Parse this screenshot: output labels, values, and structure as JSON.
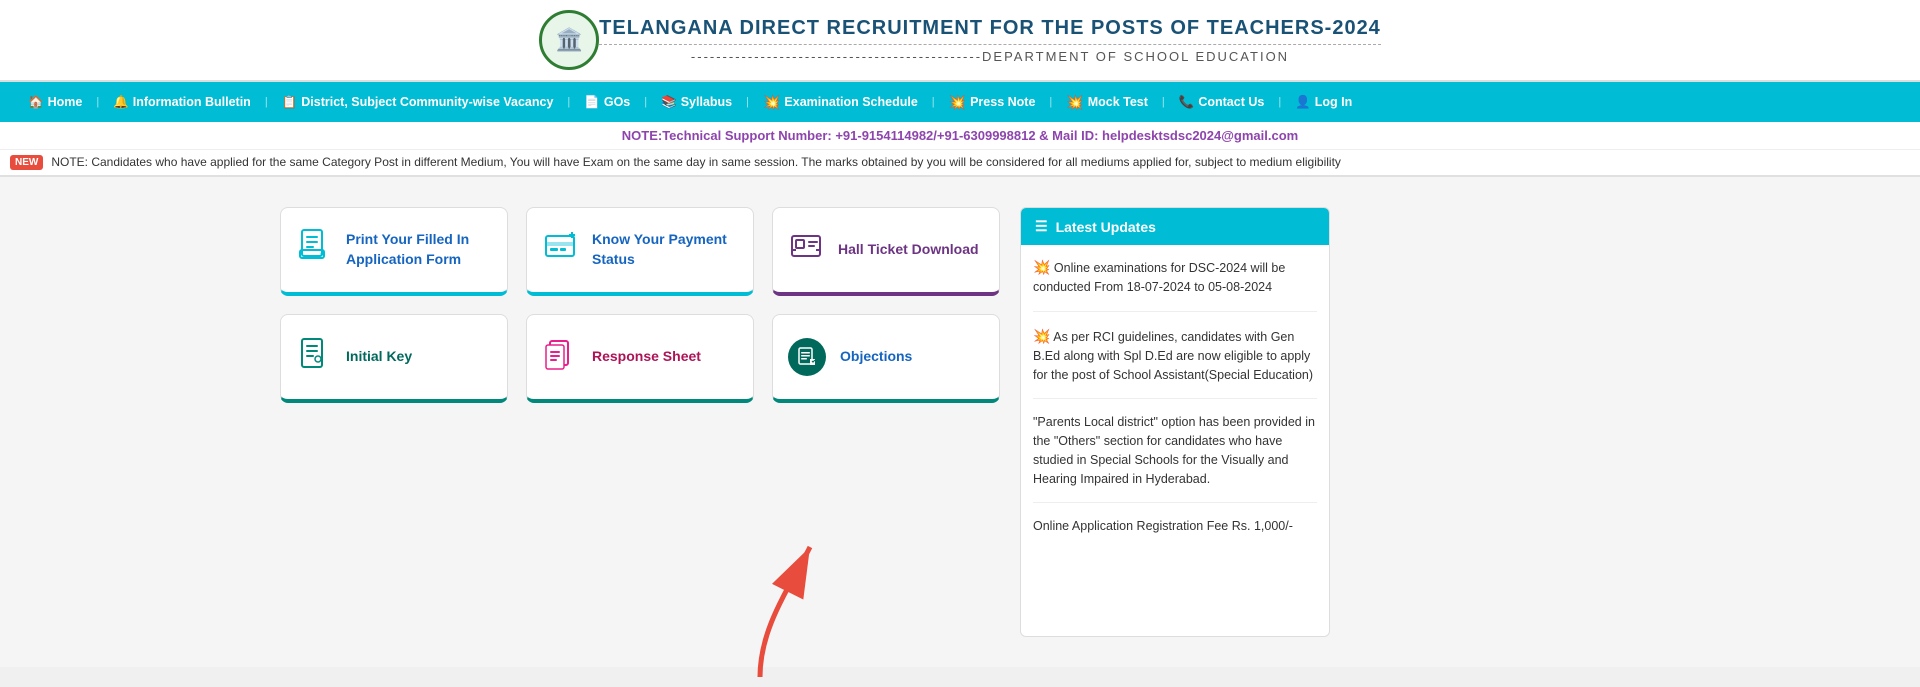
{
  "header": {
    "title": "TELANGANA DIRECT RECRUITMENT FOR THE POSTS OF TEACHERS-2024",
    "subtitle": "----------------------------------------------DEPARTMENT OF SCHOOL EDUCATION",
    "logo_icon": "🏛️"
  },
  "navbar": {
    "items": [
      {
        "id": "home",
        "label": "Home",
        "icon": "🏠"
      },
      {
        "id": "info-bulletin",
        "label": "Information Bulletin",
        "icon": "🔔"
      },
      {
        "id": "vacancy",
        "label": "District, Subject Community-wise Vacancy",
        "icon": "📋"
      },
      {
        "id": "gos",
        "label": "GOs",
        "icon": "📄"
      },
      {
        "id": "syllabus",
        "label": "Syllabus",
        "icon": "📚"
      },
      {
        "id": "exam-schedule",
        "label": "Examination Schedule",
        "icon": "🔥"
      },
      {
        "id": "press-note",
        "label": "Press Note",
        "icon": "🔥"
      },
      {
        "id": "mock-test",
        "label": "Mock Test",
        "icon": "🔥"
      },
      {
        "id": "contact-us",
        "label": "Contact Us",
        "icon": "📞"
      },
      {
        "id": "log-in",
        "label": "Log In",
        "icon": "👤"
      }
    ]
  },
  "notice": {
    "text": "NOTE:Technical Support Number: +91-9154114982/+91-6309998812 & Mail ID: helpdesktsdsc2024@gmail.com"
  },
  "marquee": {
    "badge": "NEW",
    "text": "NOTE: Candidates who have applied for the same Category Post in different Medium, You will have Exam on the same day in same session. The marks obtained by you will be considered for all mediums applied for, subject to medium eligibility"
  },
  "cards": [
    {
      "id": "print-application",
      "label": "Print Your Filled In Application Form",
      "icon": "📋",
      "icon_color": "cyan",
      "border_color": "cyan"
    },
    {
      "id": "payment-status",
      "label": "Know Your Payment Status",
      "icon": "💳",
      "icon_color": "cyan",
      "border_color": "cyan"
    },
    {
      "id": "hall-ticket",
      "label": "Hall Ticket Download",
      "icon": "🎫",
      "icon_color": "purple",
      "border_color": "purple"
    },
    {
      "id": "initial-key",
      "label": "Initial Key",
      "icon": "📝",
      "icon_color": "teal",
      "border_color": "teal"
    },
    {
      "id": "response-sheet",
      "label": "Response Sheet",
      "icon": "📄",
      "icon_color": "pink",
      "border_color": "teal"
    },
    {
      "id": "objections",
      "label": "Objections",
      "icon": "📋",
      "icon_color": "dark-teal",
      "border_color": "teal"
    }
  ],
  "updates_panel": {
    "title": "Latest Updates",
    "title_icon": "≡",
    "items": [
      {
        "id": "update-1",
        "text": "Online examinations for DSC-2024 will be conducted From 18-07-2024 to 05-08-2024",
        "fire": true
      },
      {
        "id": "update-2",
        "text": "As per RCI guidelines, candidates with Gen B.Ed along with Spl D.Ed are now eligible to apply for the post of School Assistant(Special Education)",
        "fire": true
      },
      {
        "id": "update-3",
        "text": "\"Parents Local district\" option has been provided in the \"Others\" section for candidates who have studied in Special Schools for the Visually and Hearing Impaired in Hyderabad.",
        "fire": false
      },
      {
        "id": "update-4",
        "text": "Online Application Registration Fee Rs. 1,000/-",
        "fire": false
      }
    ]
  }
}
